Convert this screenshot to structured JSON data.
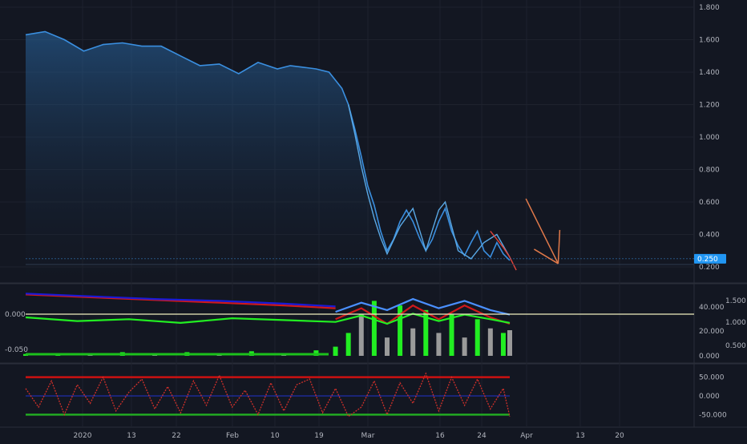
{
  "chart_data": [
    {
      "type": "line",
      "panel": "price",
      "y_ticks": [
        "1.800",
        "1.600",
        "1.400",
        "1.200",
        "1.000",
        "0.800",
        "0.600",
        "0.400",
        "0.200"
      ],
      "ylim": [
        0.1,
        1.85
      ],
      "x_ticks": [
        "2020",
        "13",
        "22",
        "Feb",
        "10",
        "19",
        "Mar",
        "16",
        "24",
        "Apr",
        "13",
        "20"
      ],
      "last_price_label": "0.250",
      "last_price": 0.25,
      "series": [
        {
          "color": "#3a8fe0",
          "fill": true,
          "x": [
            0,
            3,
            6,
            9,
            12,
            15,
            18,
            21,
            24,
            27,
            30,
            33,
            36,
            39,
            41,
            43,
            45,
            47,
            49,
            50,
            51,
            52,
            53,
            54,
            55,
            56,
            57,
            58,
            59,
            60,
            61,
            62,
            63,
            64,
            65,
            66,
            67,
            68,
            69,
            70,
            71,
            72,
            73,
            74,
            75
          ],
          "values": [
            1.63,
            1.65,
            1.6,
            1.53,
            1.57,
            1.58,
            1.56,
            1.56,
            1.5,
            1.44,
            1.45,
            1.39,
            1.46,
            1.42,
            1.44,
            1.43,
            1.42,
            1.4,
            1.3,
            1.2,
            1.05,
            0.88,
            0.7,
            0.58,
            0.42,
            0.3,
            0.37,
            0.48,
            0.55,
            0.48,
            0.38,
            0.3,
            0.37,
            0.48,
            0.56,
            0.42,
            0.33,
            0.27,
            0.35,
            0.42,
            0.3,
            0.26,
            0.35,
            0.28,
            0.24
          ]
        },
        {
          "color": "#5aa9e6",
          "x": [
            50,
            51,
            52,
            53,
            54,
            55,
            56,
            58,
            60,
            62,
            64,
            65,
            67,
            69,
            71,
            73,
            75
          ],
          "values": [
            1.2,
            1.02,
            0.82,
            0.65,
            0.5,
            0.38,
            0.28,
            0.45,
            0.56,
            0.3,
            0.55,
            0.6,
            0.3,
            0.25,
            0.35,
            0.4,
            0.26
          ]
        },
        {
          "color": "#e0433a",
          "x": [
            72,
            73,
            74,
            75,
            76
          ],
          "values": [
            0.42,
            0.37,
            0.32,
            0.26,
            0.18
          ]
        }
      ],
      "annotations": [
        {
          "shape": "arrow",
          "color": "#e0794a",
          "from": [
            77.5,
            0.62
          ],
          "to": [
            82.5,
            0.22
          ]
        }
      ]
    },
    {
      "type": "bar",
      "panel": "indicator-1",
      "y_ticks_left": [
        "0.000",
        "-0.050"
      ],
      "y_ticks_right_a": [
        "40.000",
        "20.000",
        "0.000"
      ],
      "y_ticks_right_b": [
        "1.500",
        "1.000",
        "0.500"
      ],
      "ylim": [
        0,
        70
      ],
      "reference_line": 0.0,
      "volume_colors": {
        "up": "#22ee22",
        "neutral": "#9a9a9a"
      },
      "volume": {
        "x": [
          0,
          5,
          10,
          15,
          20,
          25,
          30,
          35,
          40,
          45,
          48,
          50,
          52,
          54,
          56,
          58,
          60,
          62,
          64,
          66,
          68,
          70,
          72,
          74,
          75
        ],
        "values": [
          2,
          3,
          2,
          4,
          3,
          4,
          3,
          5,
          3,
          6,
          10,
          25,
          45,
          60,
          20,
          55,
          30,
          50,
          25,
          45,
          20,
          40,
          30,
          25,
          28
        ],
        "flags": [
          "up",
          "up",
          "neutral",
          "up",
          "neutral",
          "up",
          "neutral",
          "up",
          "neutral",
          "up",
          "up",
          "up",
          "neutral",
          "up",
          "neutral",
          "up",
          "neutral",
          "up",
          "neutral",
          "up",
          "neutral",
          "up",
          "neutral",
          "up",
          "neutral"
        ]
      },
      "series": [
        {
          "color": "#d0191c",
          "x": [
            0,
            10,
            20,
            30,
            40,
            48
          ],
          "values": [
            67,
            64,
            61,
            58,
            55,
            52
          ]
        },
        {
          "color": "#1a1ad6",
          "x": [
            0,
            10,
            20,
            30,
            40,
            48
          ],
          "values": [
            68,
            65,
            62,
            60,
            57,
            54
          ]
        },
        {
          "color": "#d0191c",
          "x": [
            48,
            52,
            56,
            60,
            64,
            68,
            72,
            75
          ],
          "values": [
            40,
            52,
            35,
            55,
            40,
            55,
            42,
            35
          ]
        },
        {
          "color": "#22ee22",
          "x": [
            0,
            8,
            16,
            24,
            32,
            40,
            48,
            52,
            56,
            60,
            64,
            68,
            72,
            75
          ],
          "values": [
            42,
            38,
            40,
            36,
            41,
            39,
            37,
            44,
            35,
            46,
            38,
            45,
            40,
            36
          ]
        },
        {
          "color": "#4a90ff",
          "x": [
            48,
            52,
            56,
            60,
            64,
            68,
            72,
            75
          ],
          "values": [
            48,
            58,
            50,
            62,
            52,
            60,
            50,
            45
          ]
        }
      ]
    },
    {
      "type": "line",
      "panel": "indicator-2",
      "y_ticks": [
        "50.000",
        "0.000",
        "-50.000"
      ],
      "ylim": [
        -75,
        75
      ],
      "levels": [
        {
          "value": 50,
          "color": "#cc1111"
        },
        {
          "value": 0,
          "color": "#2233cc"
        },
        {
          "value": -50,
          "color": "#22aa22"
        }
      ],
      "series": [
        {
          "color": "#d0302a",
          "dotted": true,
          "x": [
            0,
            2,
            4,
            6,
            8,
            10,
            12,
            14,
            16,
            18,
            20,
            22,
            24,
            26,
            28,
            30,
            32,
            34,
            36,
            38,
            40,
            42,
            44,
            46,
            48,
            50,
            52,
            54,
            56,
            58,
            60,
            62,
            64,
            66,
            68,
            70,
            72,
            74,
            75
          ],
          "values": [
            20,
            -30,
            40,
            -50,
            30,
            -20,
            50,
            -40,
            10,
            45,
            -35,
            25,
            -45,
            40,
            -25,
            55,
            -30,
            15,
            -50,
            35,
            -40,
            30,
            45,
            -45,
            20,
            -55,
            -30,
            40,
            -50,
            35,
            -20,
            60,
            -40,
            50,
            -25,
            45,
            -35,
            20,
            -55
          ]
        }
      ]
    }
  ]
}
